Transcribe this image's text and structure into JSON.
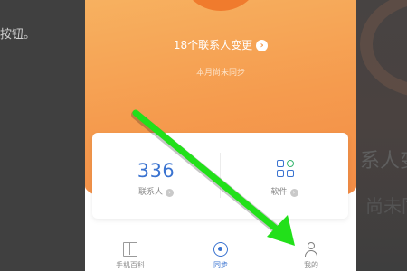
{
  "background": {
    "left_text": "按钮。",
    "right_text_1": "系人变",
    "right_text_2": "尚未同"
  },
  "summary": {
    "changes_text": "18个联系人变更",
    "changes_chevron_icon": "chevron-right-icon",
    "status_text": "本月尚未同步"
  },
  "stats": {
    "contacts_value": "336",
    "contacts_label": "联系人",
    "apps_label": "软件",
    "apps_icon": "apps-grid-icon"
  },
  "nav": {
    "items": [
      {
        "label": "手机百科",
        "icon": "book-icon",
        "active": false
      },
      {
        "label": "同步",
        "icon": "sync-icon",
        "active": true
      },
      {
        "label": "我的",
        "icon": "person-icon",
        "active": false
      }
    ]
  },
  "colors": {
    "accent_orange": "#f59b4e",
    "accent_blue": "#3a73d0",
    "annotation_green": "#22e01a"
  },
  "annotation": {
    "type": "arrow",
    "color": "#22e01a",
    "points_to": "我的"
  }
}
